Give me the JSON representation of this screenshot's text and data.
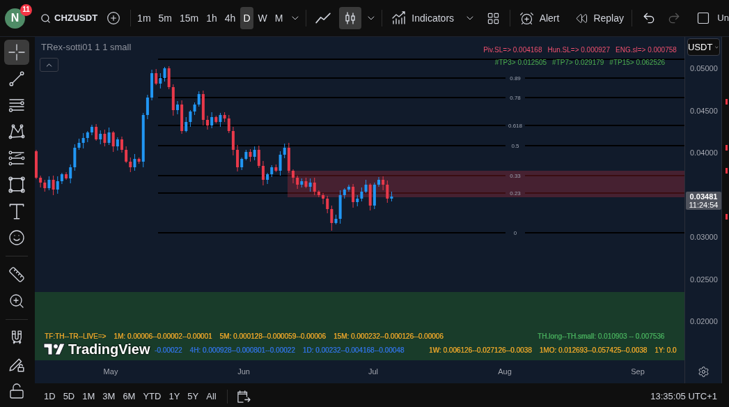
{
  "header": {
    "avatar": {
      "initial": "N",
      "badge": "11"
    },
    "symbol": "CHZUSDT",
    "intervals": [
      {
        "label": "1m",
        "selected": false
      },
      {
        "label": "5m",
        "selected": false
      },
      {
        "label": "15m",
        "selected": false
      },
      {
        "label": "1h",
        "selected": false
      },
      {
        "label": "4h",
        "selected": false
      },
      {
        "label": "D",
        "selected": true
      },
      {
        "label": "W",
        "selected": false
      },
      {
        "label": "M",
        "selected": false
      }
    ],
    "chart_types": [
      {
        "kind": "line",
        "selected": false
      },
      {
        "kind": "candles",
        "selected": true
      }
    ],
    "actions": [
      {
        "kind": "indicators",
        "label": "Indicators"
      },
      {
        "kind": "layouts"
      },
      {
        "kind": "alert",
        "label": "Alert"
      },
      {
        "kind": "replay",
        "label": "Replay"
      }
    ],
    "history": [
      {
        "kind": "undo",
        "disabled": false
      },
      {
        "kind": "redo",
        "disabled": true
      }
    ],
    "layout_label": "Un"
  },
  "drawing_tools": [
    [
      {
        "kind": "crosshair",
        "selected": true
      },
      {
        "kind": "trend-line",
        "selected": false
      },
      {
        "kind": "fib",
        "selected": false
      },
      {
        "kind": "pattern",
        "selected": false
      },
      {
        "kind": "projection",
        "selected": false
      },
      {
        "kind": "rectangle",
        "selected": false
      },
      {
        "kind": "text",
        "selected": false
      },
      {
        "kind": "emoji",
        "selected": false
      }
    ],
    [
      {
        "kind": "ruler",
        "selected": false
      },
      {
        "kind": "zoom",
        "selected": false
      }
    ],
    [
      {
        "kind": "magnet",
        "selected": false
      },
      {
        "kind": "lock-drawing",
        "selected": false
      },
      {
        "kind": "lock",
        "selected": false
      }
    ]
  ],
  "chart": {
    "legend": "TRex-sotti01 1 1 small",
    "signal_rows": [
      {
        "color": "#f0506e",
        "items": [
          "Piv.SL=> 0.004168",
          "Hun.SL=> 0.000927",
          "ENG.sl=> 0.000758"
        ]
      },
      {
        "color": "#4caf50",
        "items": [
          "#TP3> 0.012505",
          "#TP7> 0.029179",
          "#TP15> 0.062526"
        ]
      }
    ],
    "fib_levels": [
      {
        "label": "0.89"
      },
      {
        "label": "0.78"
      },
      {
        "label": "0.618"
      },
      {
        "label": "0.5"
      },
      {
        "label": "0.33"
      },
      {
        "label": "0.23"
      },
      {
        "label": "0"
      }
    ],
    "indicator_table": {
      "rows": [
        {
          "groups": [
            {
              "color": "#e5a32a",
              "items": [
                "TF:TH--TR--LIVE=>",
                "1M: 0.00006--0.00002--0.00001",
                "5M: 0.000128--0.000059--0.00006",
                "15M: 0.000232--0.000126--0.00006"
              ]
            },
            {
              "color": "#45a85a",
              "items": [
                "TH.long--TH.small: 0.010903 -- 0.007536"
              ]
            }
          ]
        },
        {
          "groups": [
            {
              "color": "#2f6fd8",
              "items": [
                "-0.00022",
                "4H: 0.000928--0.000801--0.00022",
                "1D: 0.00232--0.004168--0.00048"
              ]
            },
            {
              "color": "#e5a32a",
              "items": [
                "1W: 0.006126--0.027126--0.0038",
                "1MO: 0.012693--0.057425--0.0038",
                "1Y: 0.0"
              ]
            }
          ]
        }
      ]
    },
    "logo": "TradingView"
  },
  "price_axis": {
    "currency": "USDT",
    "ticks": [
      "0.05000",
      "0.04500",
      "0.04000",
      "0.03000",
      "0.02500",
      "0.02000"
    ],
    "last_price": "0.03481",
    "countdown": "11:24:54"
  },
  "time_axis": {
    "labels": [
      "May",
      "Jun",
      "Jul",
      "Aug",
      "Sep"
    ]
  },
  "bottom_bar": {
    "ranges": [
      "1D",
      "5D",
      "1M",
      "3M",
      "6M",
      "YTD",
      "1Y",
      "5Y",
      "All"
    ],
    "clock": "13:35:05 UTC+1"
  }
}
